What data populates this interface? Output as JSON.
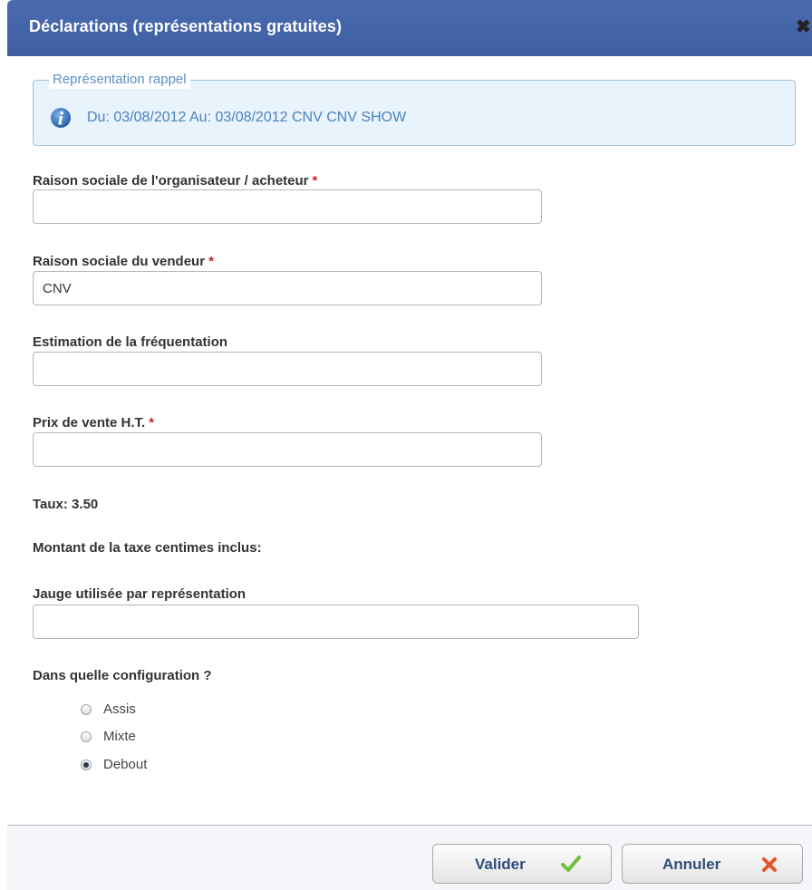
{
  "dialog": {
    "title": "Déclarations (représentations gratuites)",
    "close_glyph": "✖"
  },
  "reminder": {
    "legend": "Représentation rappel",
    "text": "Du: 03/08/2012 Au: 03/08/2012 CNV CNV SHOW",
    "icon": "info-icon"
  },
  "form": {
    "organizer": {
      "label": "Raison sociale de l'organisateur / acheteur",
      "required_mark": "*",
      "value": ""
    },
    "seller": {
      "label": "Raison sociale du vendeur",
      "required_mark": "*",
      "value": "CNV"
    },
    "attendance": {
      "label": "Estimation de la fréquentation",
      "value": ""
    },
    "price": {
      "label": "Prix de vente H.T.",
      "required_mark": "*",
      "value": ""
    },
    "rate_text": "Taux: 3.50",
    "tax_amount_label": "Montant de la taxe centimes inclus:",
    "gauge": {
      "label": "Jauge utilisée par représentation",
      "value": ""
    },
    "configuration": {
      "label": "Dans quelle configuration ?",
      "options": [
        "Assis",
        "Mixte",
        "Debout"
      ],
      "selected": "Debout"
    }
  },
  "footer": {
    "validate_label": "Valider",
    "validate_icon": "checkmark-icon",
    "cancel_label": "Annuler",
    "cancel_icon": "cross-icon",
    "colors": {
      "check": "#6cbf3a",
      "cross": "#e5542a",
      "header": "#4565a8"
    }
  }
}
